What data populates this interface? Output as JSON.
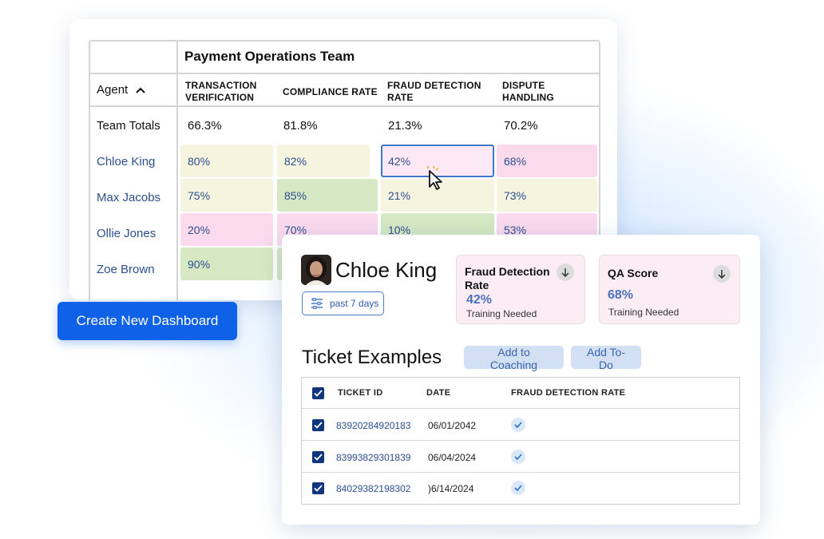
{
  "team_table": {
    "title": "Payment Operations Team",
    "agent_header": "Agent",
    "columns": [
      [
        "TRANSACTION",
        "VERIFICATION"
      ],
      [
        "COMPLIANCE RATE"
      ],
      [
        "FRAUD DETECTION",
        "RATE"
      ],
      [
        "DISPUTE",
        "HANDLING"
      ]
    ],
    "totals": {
      "label": "Team Totals",
      "values": [
        "66.3%",
        "81.8%",
        "21.3%",
        "70.2%"
      ]
    },
    "rows": [
      {
        "name": "Chloe King",
        "values": [
          "80%",
          "82%",
          "42%",
          "68%"
        ],
        "colors": [
          "yellow",
          "yellow",
          "selected",
          "pink"
        ]
      },
      {
        "name": "Max Jacobs",
        "values": [
          "75%",
          "85%",
          "21%",
          "73%"
        ],
        "colors": [
          "yellow",
          "green",
          "yellow",
          "yellow"
        ]
      },
      {
        "name": "Ollie Jones",
        "values": [
          "20%",
          "70%",
          "10%",
          "53%"
        ],
        "colors": [
          "pink",
          "pink",
          "green",
          "pink"
        ]
      },
      {
        "name": "Zoe Brown",
        "values": [
          "90%",
          "",
          "",
          ""
        ],
        "colors": [
          "green",
          "green",
          "",
          ""
        ]
      }
    ]
  },
  "create_button": "Create New Dashboard",
  "agent_detail": {
    "name": "Chloe King",
    "period": "past 7 days",
    "metrics": [
      {
        "title": [
          "Fraud Detection",
          "Rate"
        ],
        "value": "42%",
        "status": "Training Needed"
      },
      {
        "title": [
          "QA Score"
        ],
        "value": "68%",
        "status": "Training Needed"
      }
    ],
    "section_title": "Ticket Examples",
    "add_coaching": "Add to Coaching",
    "add_todo": "Add To-Do",
    "ticket_headers": [
      "TICKET ID",
      "DATE",
      "FRAUD DETECTION RATE"
    ],
    "tickets": [
      {
        "id": "83920284920183",
        "date": "06/01/2042"
      },
      {
        "id": "83993829301839",
        "date": "06/04/2024"
      },
      {
        "id": "84029382198302",
        "date": ")6/14/2024"
      }
    ]
  },
  "colors": {
    "accent": "#0f62e8",
    "cell_yellow": "#f4f4df",
    "cell_green": "#d6e9c4",
    "cell_pink": "#fbdaee",
    "link": "#2d4f8f"
  }
}
